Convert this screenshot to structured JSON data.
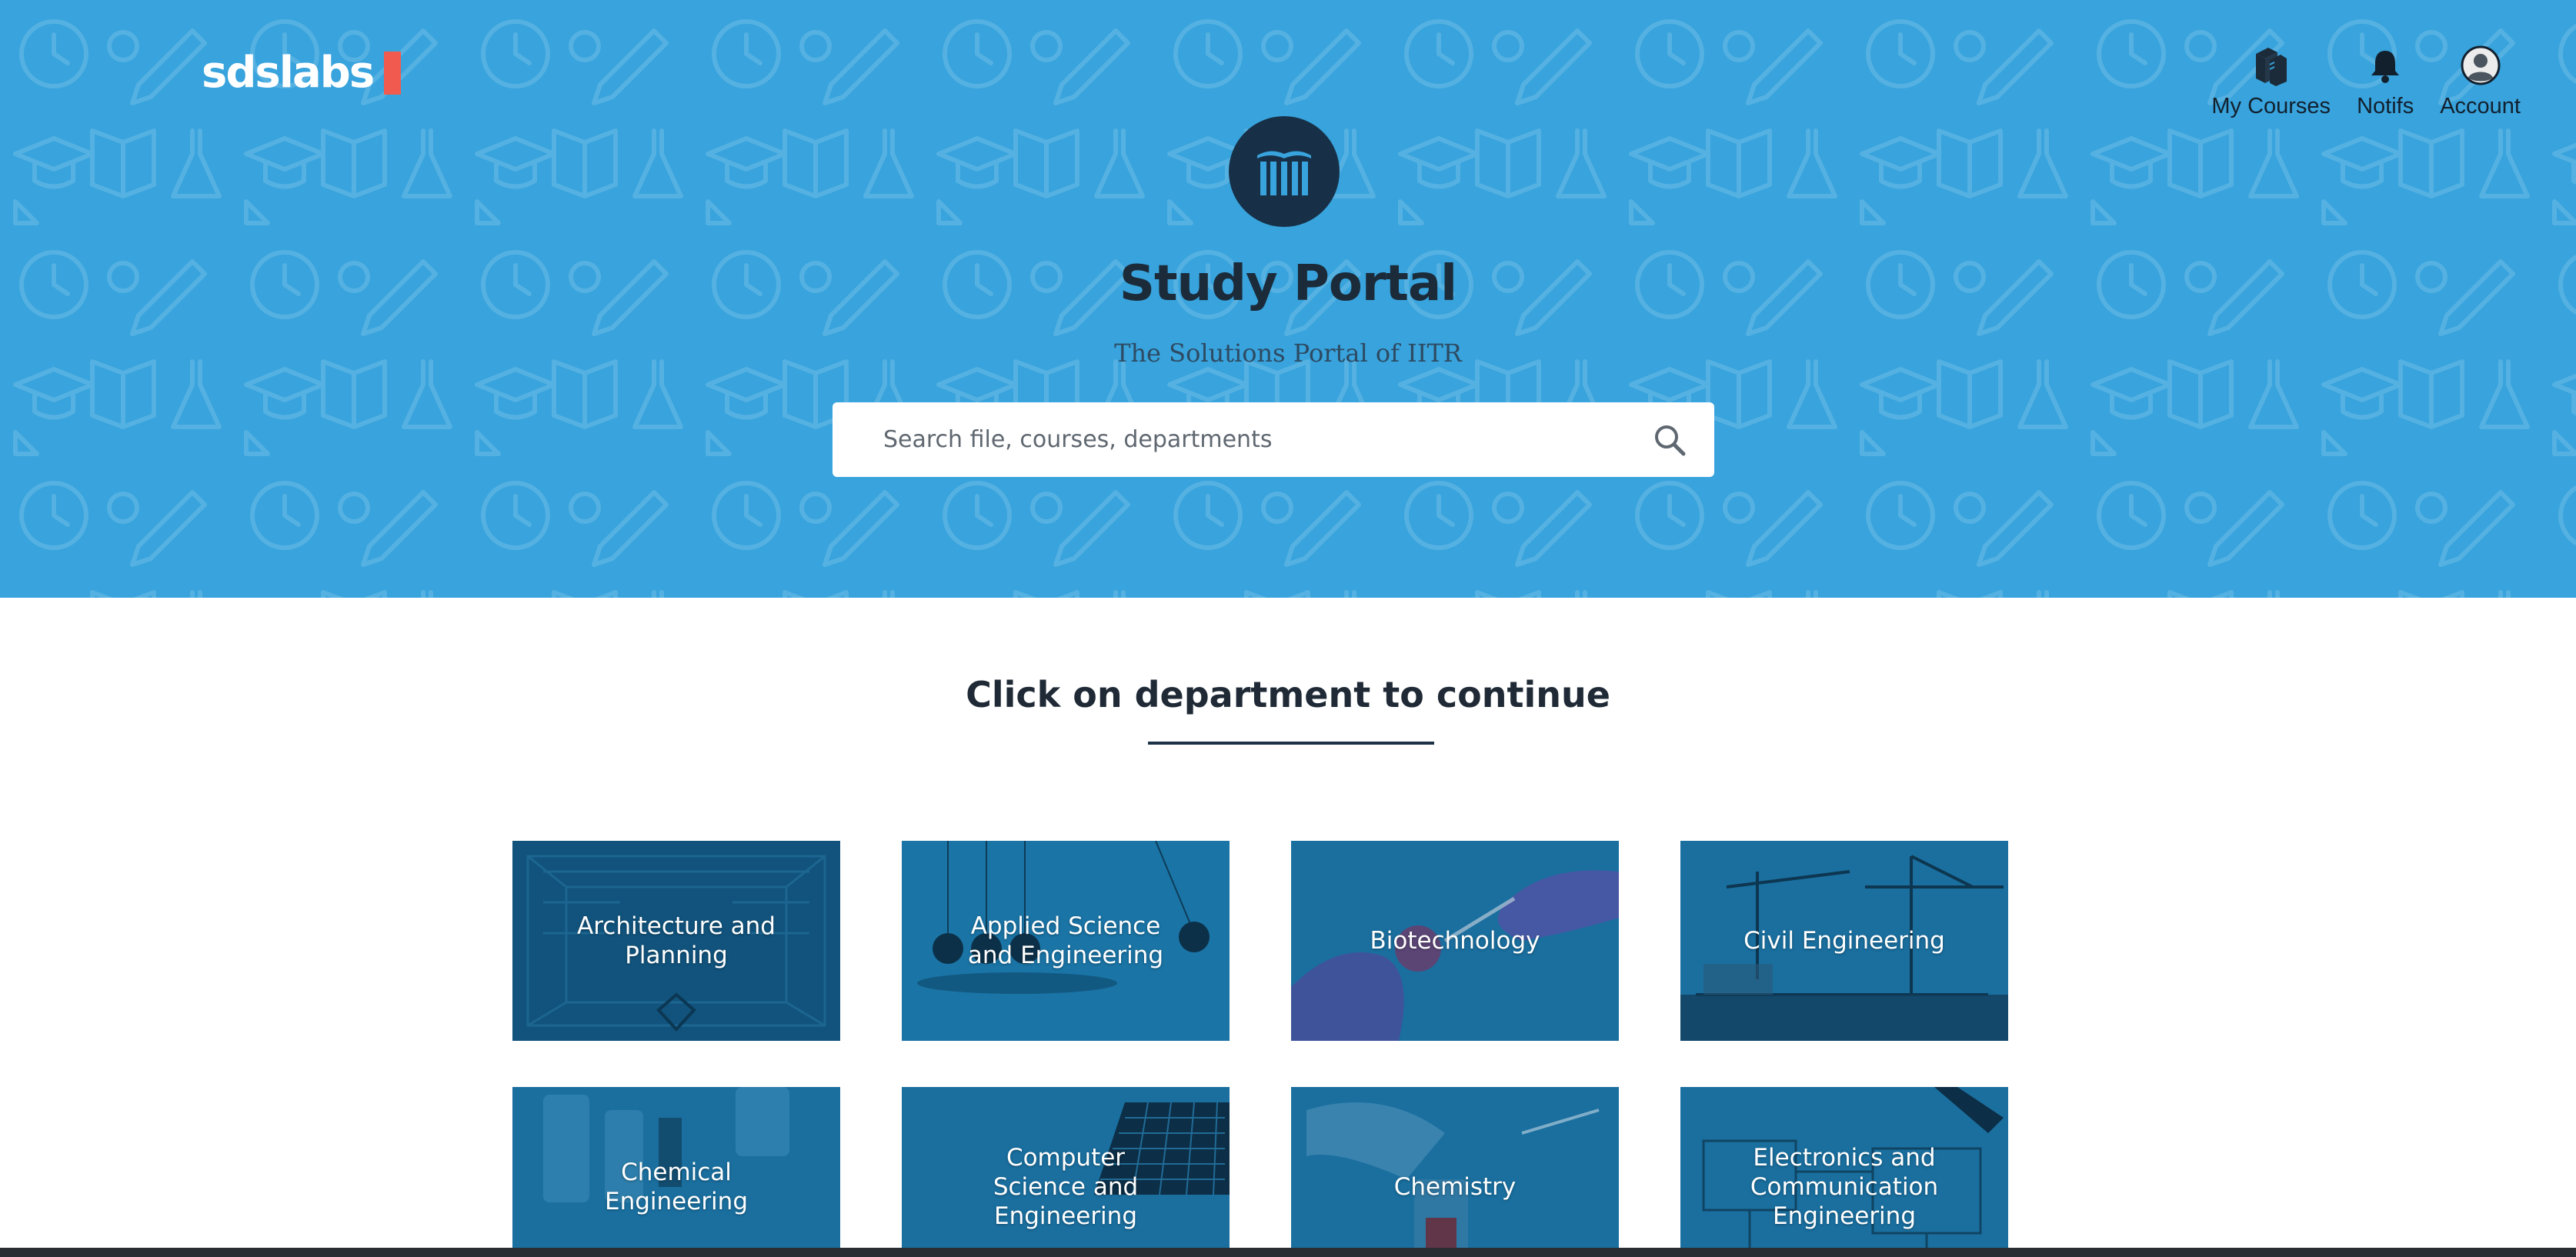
{
  "header": {
    "logo_text": "sdslabs",
    "nav": [
      {
        "label": "My Courses",
        "icon": "books-icon"
      },
      {
        "label": "Notifs",
        "icon": "bell-icon"
      },
      {
        "label": "Account",
        "icon": "account-icon"
      }
    ]
  },
  "hero": {
    "title": "Study Portal",
    "subtitle": "The Solutions Portal of IITR",
    "brand_icon": "library-icon",
    "search": {
      "placeholder": "Search file, courses, departments",
      "value": ""
    }
  },
  "main": {
    "heading": "Click on department to continue",
    "departments": [
      {
        "label": "Architecture and Planning"
      },
      {
        "label": "Applied Science and Engineering"
      },
      {
        "label": "Biotechnology"
      },
      {
        "label": "Civil Engineering"
      },
      {
        "label": "Chemical Engineering"
      },
      {
        "label": "Computer Science and Engineering"
      },
      {
        "label": "Chemistry"
      },
      {
        "label": "Electronics and Communication Engineering"
      }
    ]
  },
  "colors": {
    "hero_bg": "#38a3dc",
    "brand_dark": "#173047",
    "logo_accent": "#f15a4f",
    "card_tint": "#1a6f9f"
  }
}
